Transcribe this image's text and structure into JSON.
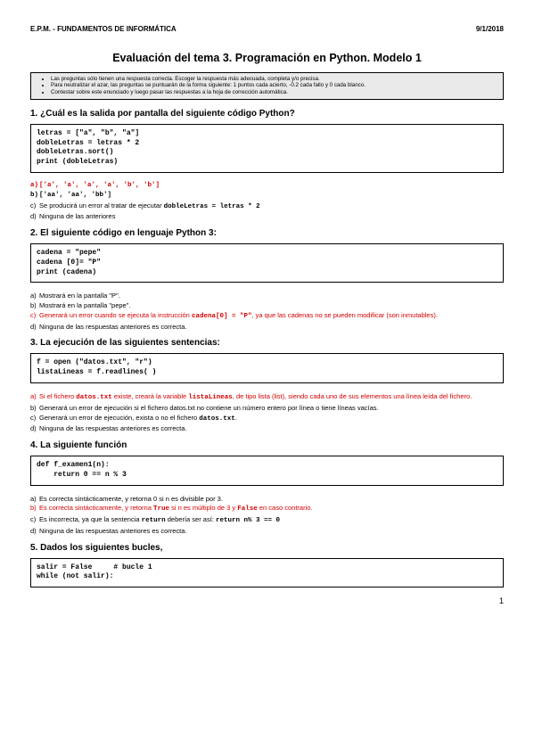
{
  "header": {
    "left": "E.P.M. - FUNDAMENTOS DE INFORMÁTICA",
    "right": "9/1/2018"
  },
  "title": "Evaluación del tema 3. Programación en Python. Modelo 1",
  "instructions": [
    "Las preguntas sólo tienen una respuesta correcta. Escoger la respuesta más adecuada, completa y/o precisa.",
    "Para neutralizar el azar, las preguntas se puntuarán de la forma siguiente: 1 puntos cada acierto, -0.2 cada fallo y 0 cada blanco.",
    "Contestar sobre este enunciado y luego pasar las respuestas a la hoja de corrección automática."
  ],
  "q1": {
    "title": "1.  ¿Cuál es la salida por pantalla del siguiente código Python?",
    "code": "letras = [\"a\", \"b\", \"a\"]\ndobleLetras = letras * 2\ndobleLetras.sort()\nprint (dobleLetras)",
    "a": "['a', 'a', 'a', 'a', 'b', 'b']",
    "b": "['aa', 'aa', 'bb']",
    "c_pre": "Se producirá un error al tratar de ejecutar ",
    "c_code": "dobleLetras = letras * 2",
    "d": "Ninguna de las anteriores"
  },
  "q2": {
    "title": "2.  El siguiente código en lenguaje Python 3:",
    "code": "cadena = \"pepe\"\ncadena [0]= \"P\"\nprint (cadena)",
    "a": "Mostrará en la pantalla \"P\".",
    "b": "Mostrará en la pantalla \"pepe\".",
    "c_pre": "Generará un error cuando se ejecuta la instrucción ",
    "c_code": "cadena[0] = \"P\"",
    "c_post": ", ya que las cadenas no se pueden modificar (son inmutables).",
    "d": "Ninguna de las respuestas anteriores es correcta."
  },
  "q3": {
    "title": "3.  La ejecución de las siguientes sentencias:",
    "code": "f = open (\"datos.txt\", \"r\")\nlistaLineas = f.readlines( )",
    "a_pre": "Si el fichero ",
    "a_c1": "datos.txt",
    "a_mid": " existe, creará la variable ",
    "a_c2": "listaLineas",
    "a_post": ", de tipo lista (list), siendo cada uno de sus elementos una línea leída del fichero.",
    "b": "Generará un error de ejecución si el fichero datos.txt no contiene un número entero por línea o tiene líneas vacías.",
    "c_pre": "Generará un error de ejecución, exista o no el fichero ",
    "c_code": "datos.txt",
    "c_post": ".",
    "d": "Ninguna de las respuestas anteriores es correcta."
  },
  "q4": {
    "title": "4.  La siguiente función",
    "code": "def f_examen1(n):\n    return 0 == n % 3",
    "a": "Es correcta sintácticamente, y retorna 0 si n es divisible por 3.",
    "b_pre": "Es correcta sintácticamente, y retorna ",
    "b_c1": "True",
    "b_mid": " si n es múltiplo de 3 y ",
    "b_c2": "False",
    "b_post": " en caso contrario.",
    "c_pre": "Es incorrecta, ya que la sentencia ",
    "c_c1": "return",
    "c_mid": " debería ser así: ",
    "c_c2": "return n% 3 == 0",
    "d": "Ninguna de las respuestas anteriores es correcta."
  },
  "q5": {
    "title": "5.  Dados los siguientes bucles,",
    "code": "salir = False     # bucle 1\nwhile (not salir):"
  },
  "page": "1"
}
